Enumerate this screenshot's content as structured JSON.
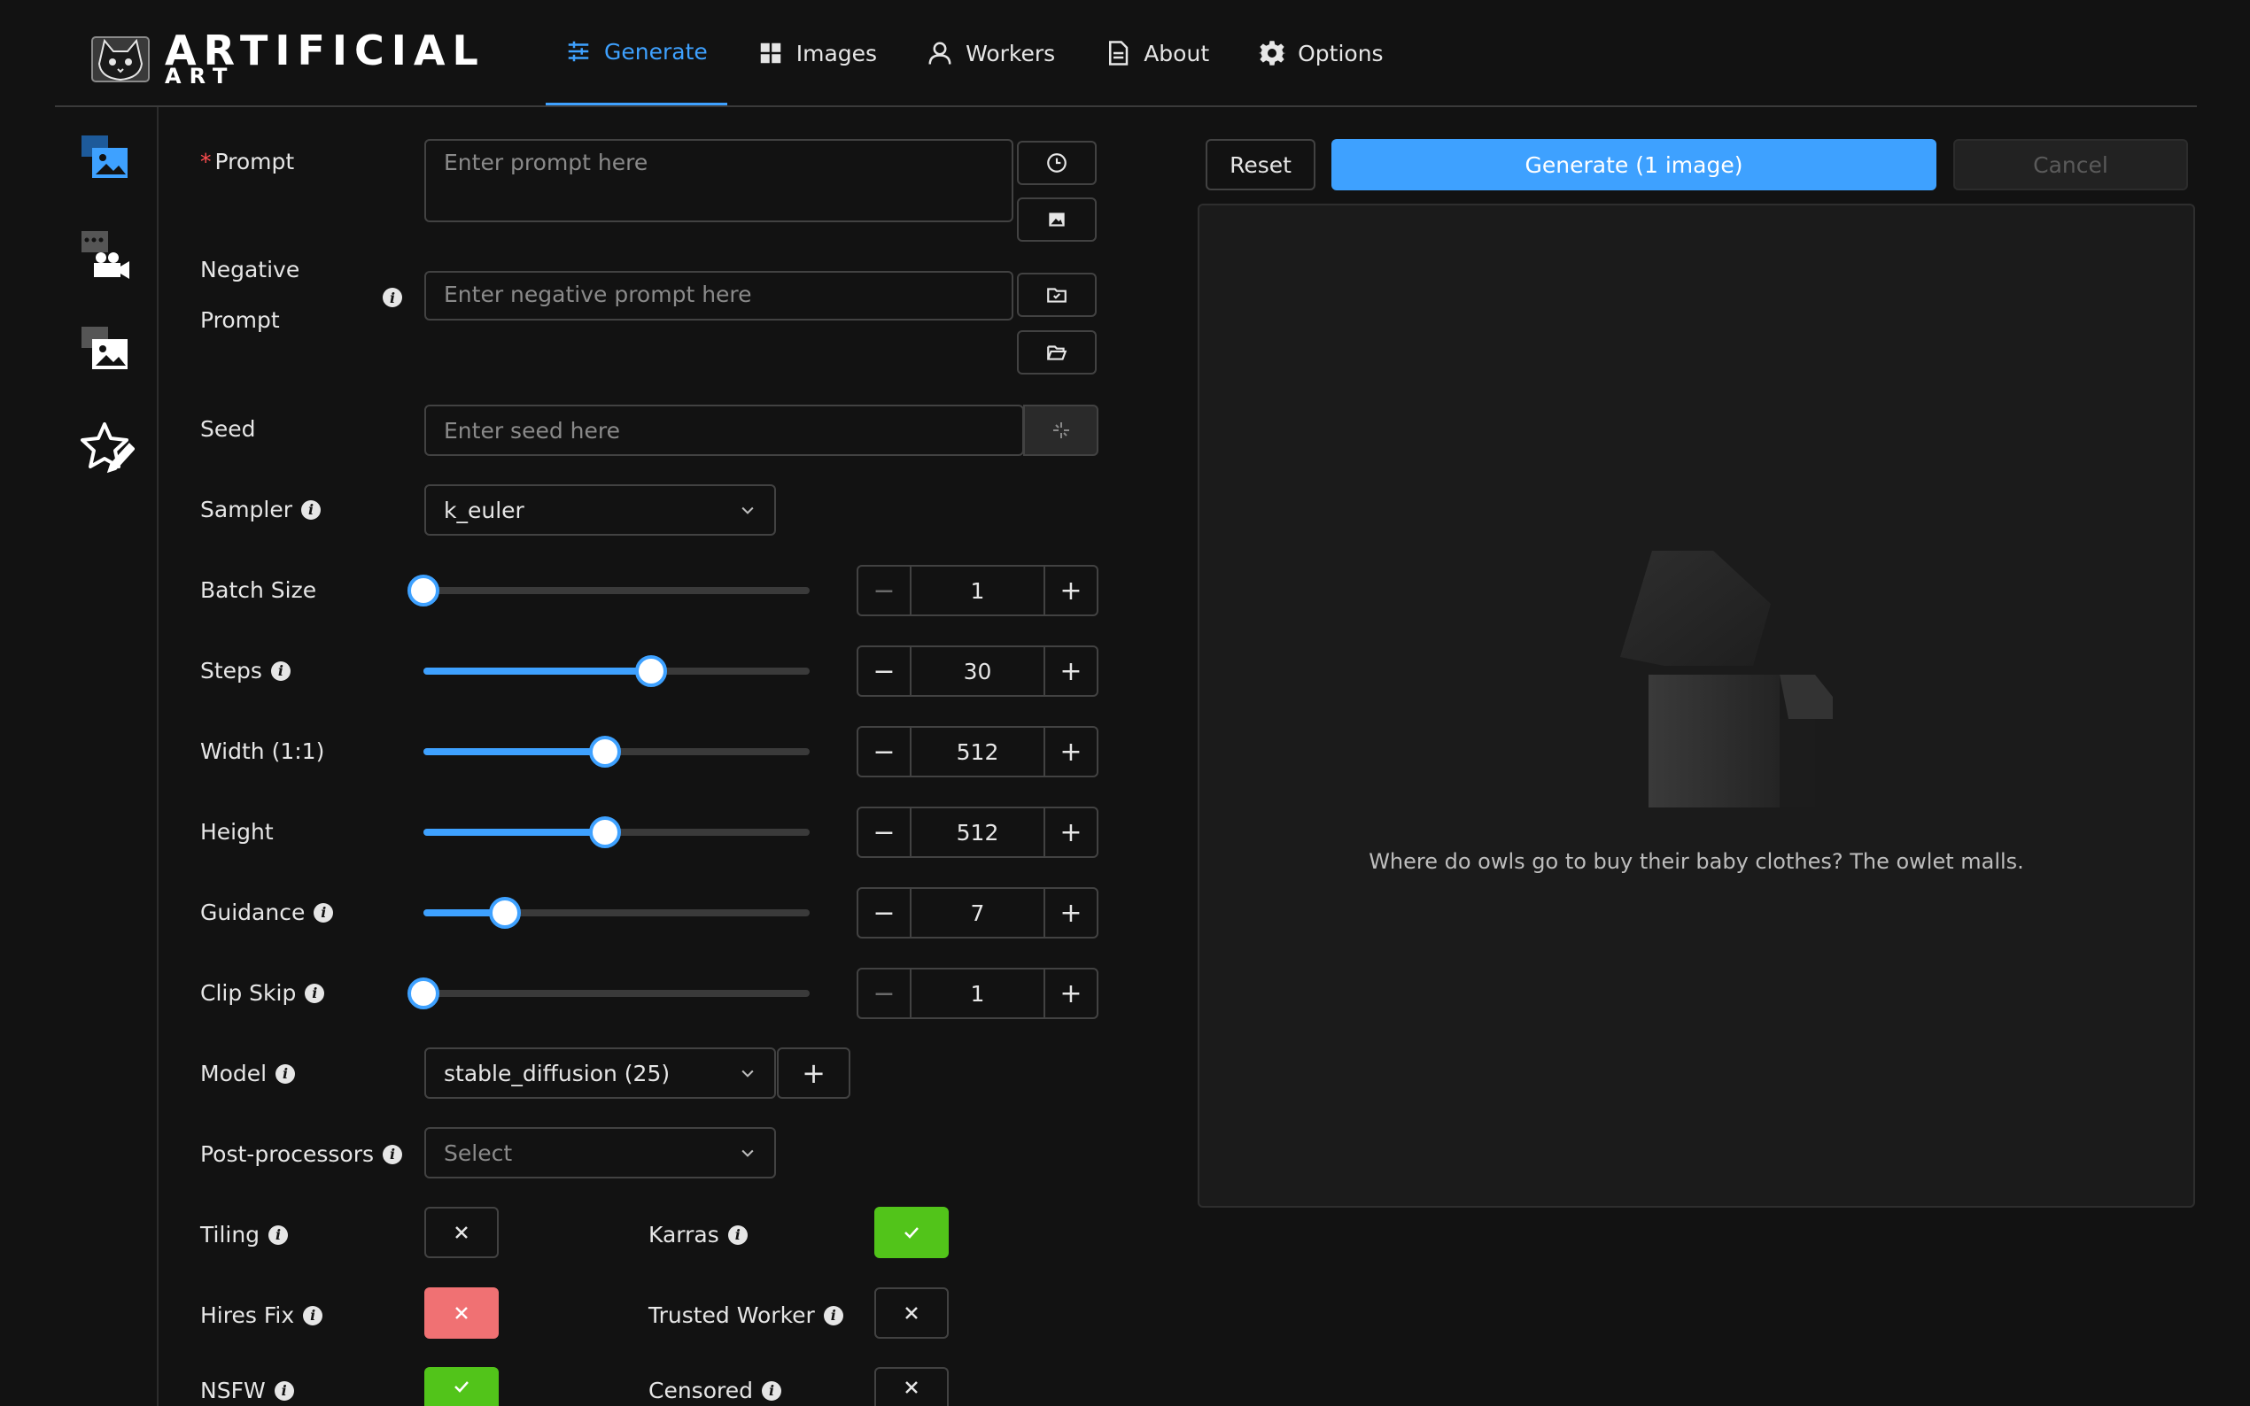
{
  "app": {
    "logo_title": "ARTIFICIAL",
    "logo_subtitle": "ART"
  },
  "nav": [
    {
      "label": "Generate",
      "icon": "sliders-icon",
      "active": true
    },
    {
      "label": "Images",
      "icon": "grid-icon"
    },
    {
      "label": "Workers",
      "icon": "user-icon"
    },
    {
      "label": "About",
      "icon": "document-icon"
    },
    {
      "label": "Options",
      "icon": "gear-icon"
    }
  ],
  "sidebar": [
    "text-to-image-icon",
    "video-icon",
    "image-to-image-icon",
    "star-edit-icon"
  ],
  "form": {
    "prompt_label": "Prompt",
    "prompt_placeholder": "Enter prompt here",
    "negative_label_1": "Negative",
    "negative_label_2": "Prompt",
    "negative_placeholder": "Enter negative prompt here",
    "seed_label": "Seed",
    "seed_placeholder": "Enter seed here",
    "sampler_label": "Sampler",
    "sampler_value": "k_euler",
    "batch_label": "Batch Size",
    "batch_value": "1",
    "batch_fraction": 0,
    "steps_label": "Steps",
    "steps_value": "30",
    "steps_fraction": 0.59,
    "width_label": "Width (1:1)",
    "width_value": "512",
    "width_fraction": 0.47,
    "height_label": "Height",
    "height_value": "512",
    "height_fraction": 0.47,
    "guidance_label": "Guidance",
    "guidance_value": "7",
    "guidance_fraction": 0.21,
    "clipskip_label": "Clip Skip",
    "clipskip_value": "1",
    "clipskip_fraction": 0,
    "model_label": "Model",
    "model_value": "stable_diffusion (25)",
    "post_label": "Post-processors",
    "post_placeholder": "Select",
    "tiling_label": "Tiling",
    "tiling": false,
    "karras_label": "Karras",
    "karras": true,
    "hires_label": "Hires Fix",
    "hires": false,
    "trusted_label": "Trusted Worker",
    "trusted": false,
    "nsfw_label": "NSFW",
    "nsfw": true,
    "censored_label": "Censored",
    "censored": false
  },
  "actions": {
    "reset": "Reset",
    "generate": "Generate (1 image)",
    "cancel": "Cancel"
  },
  "preview": {
    "empty_message": "Where do owls go to buy their baby clothes? The owlet malls."
  },
  "colors": {
    "accent": "#3ea1ff",
    "success": "#52c41a",
    "danger": "#f07173",
    "background": "#121212"
  }
}
